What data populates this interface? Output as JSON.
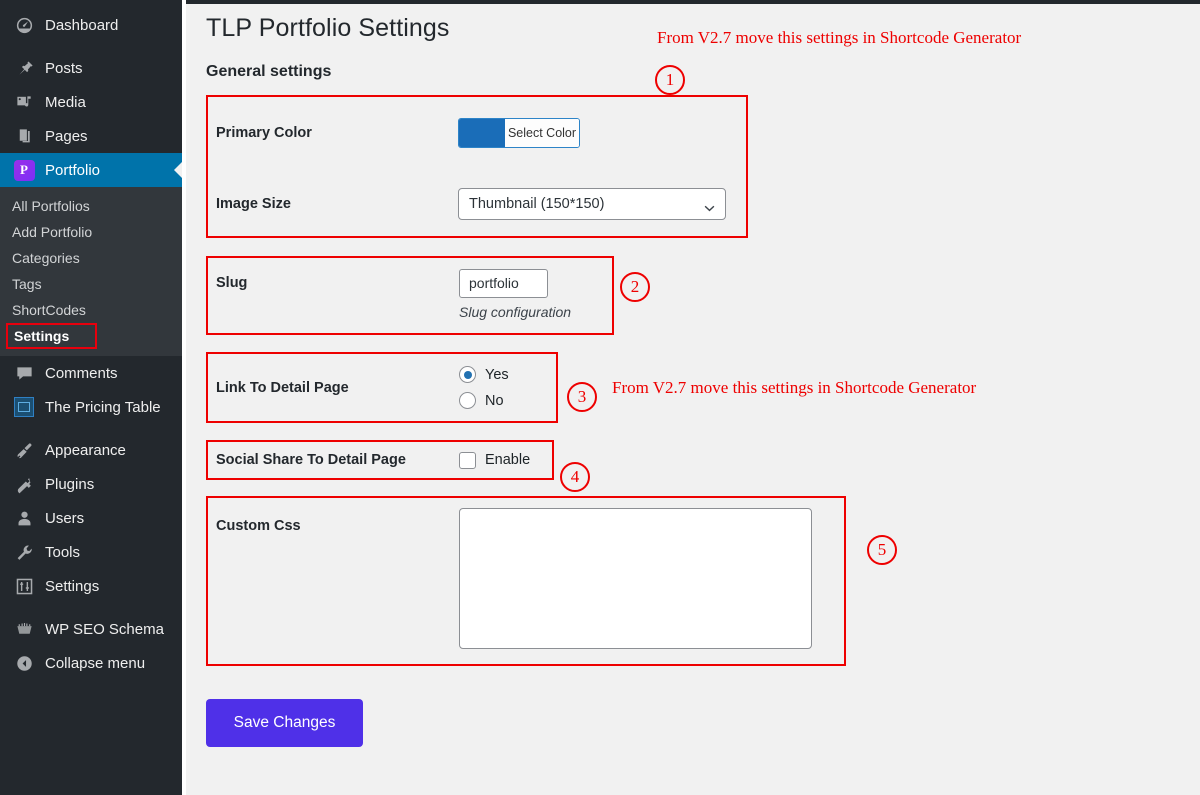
{
  "sidebar": {
    "items": [
      {
        "label": "Dashboard",
        "icon": "dashboard-gauge-icon",
        "current": false
      },
      {
        "label": "Posts",
        "icon": "pushpin-icon",
        "current": false
      },
      {
        "label": "Media",
        "icon": "media-icon",
        "current": false
      },
      {
        "label": "Pages",
        "icon": "pages-icon",
        "current": false
      },
      {
        "label": "Portfolio",
        "icon": "portfolio-p-badge-icon",
        "current": true
      },
      {
        "label": "Comments",
        "icon": "comment-bubble-icon",
        "current": false
      },
      {
        "label": "The Pricing Table",
        "icon": "pricing-table-icon",
        "current": false
      },
      {
        "label": "Appearance",
        "icon": "paintbrush-icon",
        "current": false
      },
      {
        "label": "Plugins",
        "icon": "plugin-plug-icon",
        "current": false
      },
      {
        "label": "Users",
        "icon": "user-icon",
        "current": false
      },
      {
        "label": "Tools",
        "icon": "wrench-icon",
        "current": false
      },
      {
        "label": "Settings",
        "icon": "settings-sliders-icon",
        "current": false
      },
      {
        "label": "WP SEO Schema",
        "icon": "wp-seo-schema-icon",
        "current": false
      },
      {
        "label": "Collapse menu",
        "icon": "collapse-arrow-icon",
        "current": false
      }
    ],
    "portfolio_submenu": [
      {
        "label": "All Portfolios",
        "selected": false
      },
      {
        "label": "Add Portfolio",
        "selected": false
      },
      {
        "label": "Categories",
        "selected": false
      },
      {
        "label": "Tags",
        "selected": false
      },
      {
        "label": "ShortCodes",
        "selected": false
      },
      {
        "label": "Settings",
        "selected": true
      }
    ]
  },
  "page": {
    "title": "TLP Portfolio Settings",
    "section_title": "General settings"
  },
  "fields": {
    "primary_color": {
      "label": "Primary Color",
      "button_label": "Select Color",
      "swatch_hex": "#1a6db8"
    },
    "image_size": {
      "label": "Image Size",
      "value": "Thumbnail (150*150)"
    },
    "slug": {
      "label": "Slug",
      "value": "portfolio",
      "help": "Slug configuration"
    },
    "link_to_detail_page": {
      "label": "Link To Detail Page",
      "options": [
        {
          "label": "Yes",
          "selected": true
        },
        {
          "label": "No",
          "selected": false
        }
      ]
    },
    "social_share": {
      "label": "Social Share To Detail Page",
      "checkbox_label": "Enable",
      "checked": false
    },
    "custom_css": {
      "label": "Custom Css",
      "value": ""
    }
  },
  "actions": {
    "save_label": "Save Changes",
    "save_color": "#4f30e8"
  },
  "annotations": {
    "color": "#ee0000",
    "markers": [
      {
        "id": "1",
        "number": "1"
      },
      {
        "id": "2",
        "number": "2"
      },
      {
        "id": "3",
        "number": "3"
      },
      {
        "id": "4",
        "number": "4"
      },
      {
        "id": "5",
        "number": "5"
      }
    ],
    "note_top": "From V2.7 move this settings in Shortcode Generator",
    "note_link": "From V2.7 move this settings in Shortcode Generator"
  }
}
